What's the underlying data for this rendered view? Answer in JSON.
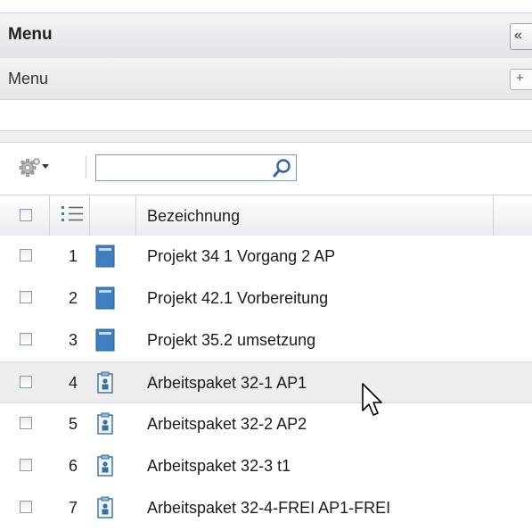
{
  "panel": {
    "title": "Menu",
    "collapse_label": "«",
    "subheader_title": "Menu",
    "expand_label": "+"
  },
  "toolbar": {
    "gear_icon": "gear-icon",
    "search_value": "",
    "search_placeholder": "",
    "search_icon": "search-icon"
  },
  "grid": {
    "column_header": "Bezeichnung",
    "rows": [
      {
        "num": "1",
        "name": "Projekt 34 1 Vorgang 2 AP",
        "icon": "project-icon"
      },
      {
        "num": "2",
        "name": "Projekt 42.1 Vorbereitung",
        "icon": "project-icon"
      },
      {
        "num": "3",
        "name": "Projekt 35.2 umsetzung",
        "icon": "project-icon"
      },
      {
        "num": "4",
        "name": "Arbeitspaket 32-1 AP1",
        "icon": "work-package-icon"
      },
      {
        "num": "5",
        "name": "Arbeitspaket 32-2 AP2",
        "icon": "work-package-icon"
      },
      {
        "num": "6",
        "name": "Arbeitspaket 32-3 t1",
        "icon": "work-package-icon"
      },
      {
        "num": "7",
        "name": "Arbeitspaket 32-4-FREI AP1-FREI",
        "icon": "work-package-icon"
      }
    ]
  },
  "colors": {
    "project_icon": "#3d7fc1",
    "header_gradient_top": "#f4f5f7",
    "header_gradient_bottom": "#dfe3e8",
    "hover_row": "#ededed"
  }
}
